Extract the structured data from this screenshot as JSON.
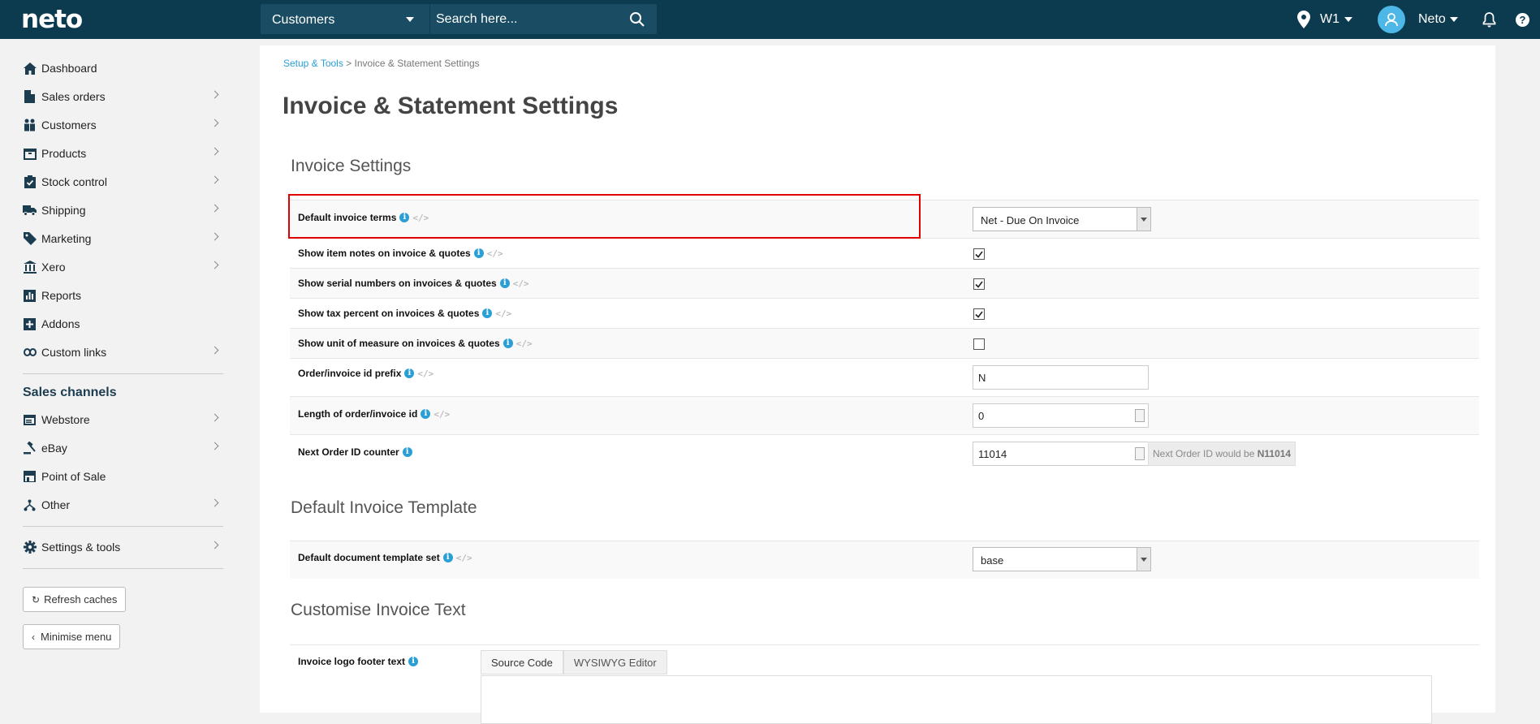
{
  "topbar": {
    "logo": "neto",
    "search_type": "Customers",
    "search_placeholder": "Search here...",
    "location": "W1",
    "user": "Neto",
    "help": "?"
  },
  "sidebar": {
    "items": [
      {
        "label": "Dashboard",
        "icon": "home-icon"
      },
      {
        "label": "Sales orders",
        "icon": "document-icon"
      },
      {
        "label": "Customers",
        "icon": "people-icon"
      },
      {
        "label": "Products",
        "icon": "box-icon"
      },
      {
        "label": "Stock control",
        "icon": "clipboard-check-icon"
      },
      {
        "label": "Shipping",
        "icon": "truck-icon"
      },
      {
        "label": "Marketing",
        "icon": "tag-icon"
      },
      {
        "label": "Xero",
        "icon": "bank-icon"
      },
      {
        "label": "Reports",
        "icon": "bar-chart-icon"
      },
      {
        "label": "Addons",
        "icon": "plus-square-icon"
      },
      {
        "label": "Custom links",
        "icon": "link-icon"
      }
    ],
    "channels_heading": "Sales channels",
    "channels": [
      {
        "label": "Webstore",
        "icon": "browser-icon"
      },
      {
        "label": "eBay",
        "icon": "gavel-icon"
      },
      {
        "label": "Point of Sale",
        "icon": "store-icon"
      },
      {
        "label": "Other",
        "icon": "network-icon"
      }
    ],
    "settings": "Settings & tools",
    "refresh_caches": "Refresh caches",
    "minimise_menu": "Minimise menu"
  },
  "breadcrumb": {
    "link": "Setup & Tools",
    "separator": ">",
    "current": "Invoice & Statement Settings"
  },
  "page_title": "Invoice & Statement Settings",
  "invoice_settings": {
    "title": "Invoice Settings",
    "default_terms_label": "Default invoice terms",
    "default_terms_value": "Net - Due On Invoice",
    "item_notes_label": "Show item notes on invoice & quotes",
    "item_notes_checked": true,
    "serial_numbers_label": "Show serial numbers on invoices & quotes",
    "serial_numbers_checked": true,
    "tax_percent_label": "Show tax percent on invoices & quotes",
    "tax_percent_checked": true,
    "unit_measure_label": "Show unit of measure on invoices & quotes",
    "unit_measure_checked": false,
    "prefix_label": "Order/invoice id prefix",
    "prefix_value": "N",
    "length_label": "Length of order/invoice id",
    "length_value": "0",
    "counter_label": "Next Order ID counter",
    "counter_value": "11014",
    "next_id_text": "Next Order ID would be",
    "next_id_value": "N11014"
  },
  "template_section": {
    "title": "Default Invoice Template",
    "label": "Default document template set",
    "value": "base"
  },
  "text_section": {
    "title": "Customise Invoice Text",
    "label": "Invoice logo footer text",
    "tab_source": "Source Code",
    "tab_wysiwyg": "WYSIWYG Editor"
  },
  "colors": {
    "topbar": "#0c3b4f",
    "accent": "#2a9fd6",
    "highlight": "#e00000"
  }
}
